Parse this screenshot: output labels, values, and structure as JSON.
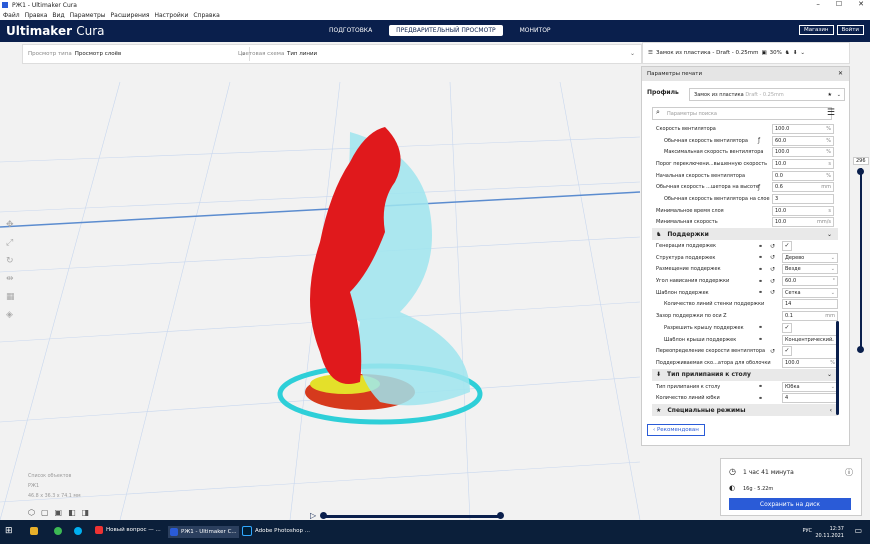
{
  "window": {
    "title": "РЖ1 - Ultimaker Cura",
    "min": "–",
    "max": "☐",
    "close": "✕"
  },
  "menu": [
    "Файл",
    "Правка",
    "Вид",
    "Параметры",
    "Расширения",
    "Настройки",
    "Справка"
  ],
  "header": {
    "brand": "Ultimaker",
    "brand2": "Cura",
    "tabs": [
      "ПОДГОТОВКА",
      "ПРЕДВАРИТЕЛЬНЫЙ ПРОСМОТР",
      "МОНИТОР"
    ],
    "active_tab": 1,
    "market": "Магазин",
    "login": "Войти"
  },
  "toolbar": {
    "view_type_label": "Просмотр типа",
    "view_type_value": "Просмотр слоёв",
    "color_scheme_label": "Цветовая схема",
    "color_scheme_value": "Тип линии"
  },
  "printbar": {
    "profile": "Замок из пластика - Draft - 0.25mm",
    "infill": "30%"
  },
  "panel": {
    "title": "Параметры печати",
    "profile_label": "Профиль",
    "profile_value": "Замок из пластика",
    "profile_hint": "Draft - 0.25mm",
    "search_placeholder": "Параметры поиска",
    "settings": [
      {
        "label": "Скорость вентилятора",
        "value": "100.0",
        "unit": "%",
        "indent": false
      },
      {
        "label": "Обычная скорость вентилятора",
        "value": "60.0",
        "unit": "%",
        "indent": true,
        "fx": true
      },
      {
        "label": "Максимальная скорость вентилятора",
        "value": "100.0",
        "unit": "%",
        "indent": true
      },
      {
        "label": "Порог переключени...вышенную скорость",
        "value": "10.0",
        "unit": "s",
        "indent": false
      },
      {
        "label": "Начальная скорость вентилятора",
        "value": "0.0",
        "unit": "%",
        "indent": false
      },
      {
        "label": "Обычная скорость ...шетора на высоте",
        "value": "0.6",
        "unit": "mm",
        "indent": false,
        "fx": true
      },
      {
        "label": "Обычная скорость вентилятора на слое",
        "value": "3",
        "unit": "",
        "indent": true
      },
      {
        "label": "Минимальное время слоя",
        "value": "10.0",
        "unit": "s",
        "indent": false
      },
      {
        "label": "Минимальная скорость",
        "value": "10.0",
        "unit": "mm/s",
        "indent": false
      }
    ],
    "support_category": "Поддержки",
    "support_settings": [
      {
        "label": "Генерация поддержек",
        "check": "✓"
      },
      {
        "label": "Структура поддержек",
        "value": "Дерево",
        "select": true
      },
      {
        "label": "Размещение поддержек",
        "value": "Везде",
        "select": true
      },
      {
        "label": "Угол нависания поддержки",
        "value": "60.0",
        "unit": "°"
      },
      {
        "label": "Шаблон поддержек",
        "value": "Сетка",
        "select": true
      },
      {
        "label": "Количество линий стенки поддержки",
        "value": "14",
        "indent": true
      },
      {
        "label": "Зазор поддержки по оси Z",
        "value": "0.1",
        "unit": "mm"
      },
      {
        "label": "Разрешить крышу поддержек",
        "check": "✓",
        "indent": true
      },
      {
        "label": "Шаблон крыши поддержек",
        "value": "Концентрический",
        "select": true,
        "indent": true
      },
      {
        "label": "Переопределение скорости вентилятора",
        "check": "✓"
      },
      {
        "label": "Поддерживаемая ско...атора для оболочки",
        "value": "100.0",
        "unit": "%"
      }
    ],
    "adhesion_category": "Тип прилипания к столу",
    "adhesion_settings": [
      {
        "label": "Тип прилипания к столу",
        "value": "Юбка",
        "select": true
      },
      {
        "label": "Количество линий юбки",
        "value": "4"
      }
    ],
    "special_category": "Специальные режимы",
    "recommended_btn": "Рекомендован"
  },
  "save": {
    "time": "1 час 41 минута",
    "material": "16g · 5.22m",
    "button": "Сохранить на диск"
  },
  "object": {
    "list": "Список объектов",
    "name": "РЖ1",
    "dims": "46.8 x 36.3 x 74.1 мм"
  },
  "layer": {
    "top": "296"
  },
  "taskbar": {
    "apps": [
      "Новый вопрос — ...",
      "РЖ1 - Ultimaker C...",
      "Adobe Photoshop ..."
    ],
    "lang": "РУС",
    "time": "12:37",
    "date": "20.11.2021"
  }
}
